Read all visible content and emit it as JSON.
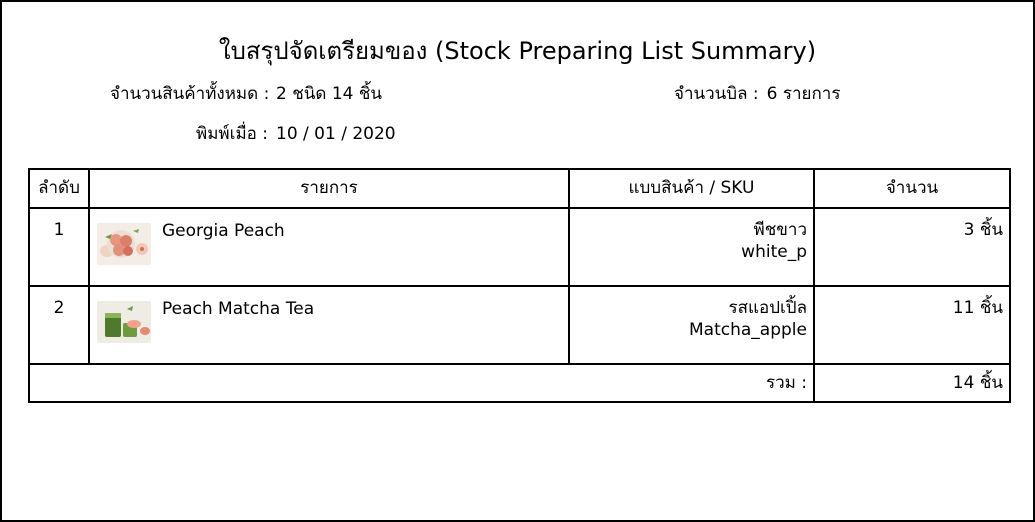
{
  "document": {
    "title": "ใบสรุปจัดเตรียมของ (Stock Preparing List Summary)",
    "total_products_label": "จำนวนสินค้าทั้งหมด :",
    "total_products_value": "2 ชนิด 14 ชิ้น",
    "bill_count_label": "จำนวนบิล :",
    "bill_count_value": "6 รายการ",
    "printed_label": "พิมพ์เมื่อ :",
    "printed_value": "10 / 01 / 2020"
  },
  "table": {
    "headers": {
      "no": "ลำดับ",
      "item": "รายการ",
      "sku": "แบบสินค้า / SKU",
      "qty": "จำนวน"
    },
    "rows": [
      {
        "no": "1",
        "name": "Georgia Peach",
        "image_icon": "peach-photo-icon",
        "variant": "พีชขาว",
        "sku": "white_p",
        "qty": "3 ชิ้น"
      },
      {
        "no": "2",
        "name": "Peach Matcha Tea",
        "image_icon": "matcha-tea-photo-icon",
        "variant": "รสแอปเปิ้ล",
        "sku": "Matcha_apple",
        "qty": "11 ชิ้น"
      }
    ],
    "total_label": "รวม :",
    "total_value": "14 ชิ้น"
  },
  "colors": {
    "border": "#000000",
    "background": "#ffffff",
    "text": "#000000"
  }
}
